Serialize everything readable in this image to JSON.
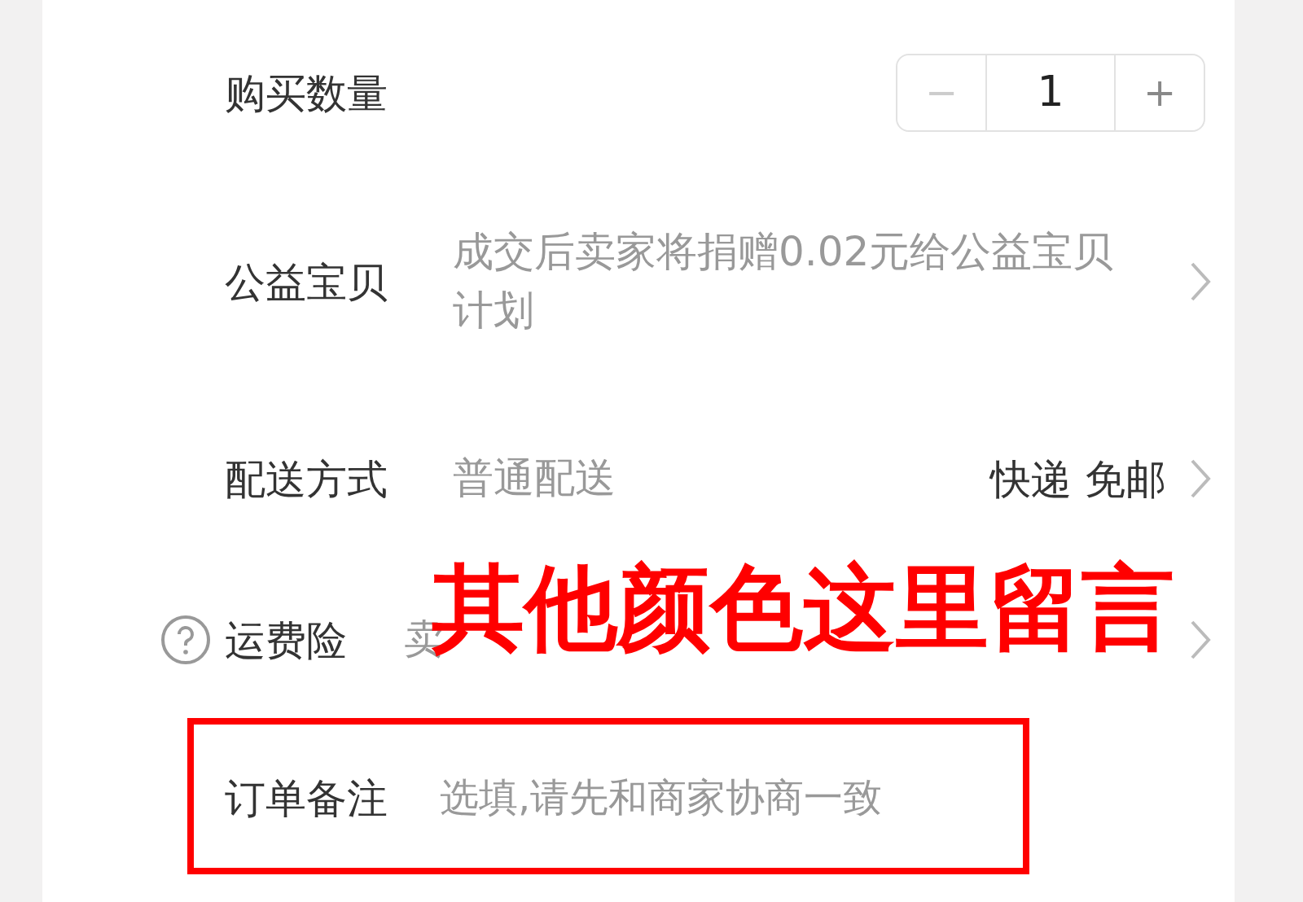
{
  "rows": [
    {
      "kind": "stepper",
      "label": "购买数量",
      "stepper": {
        "minus": "−",
        "value": "1",
        "plus": "+",
        "minus_disabled": true,
        "plus_disabled": false
      }
    },
    {
      "kind": "link",
      "label": "公益宝贝",
      "value": "成交后卖家将捐赠0.02元给公益宝贝计划"
    },
    {
      "kind": "link",
      "label": "配送方式",
      "value": "普通配送",
      "detail": "快递 免邮"
    },
    {
      "kind": "help",
      "label": "运费险",
      "value": "卖"
    },
    {
      "kind": "input",
      "highlighted": true,
      "label": "订单备注",
      "placeholder": "选填,请先和商家协商一致"
    }
  ],
  "annotation": {
    "text": "其他颜色这里留言"
  }
}
